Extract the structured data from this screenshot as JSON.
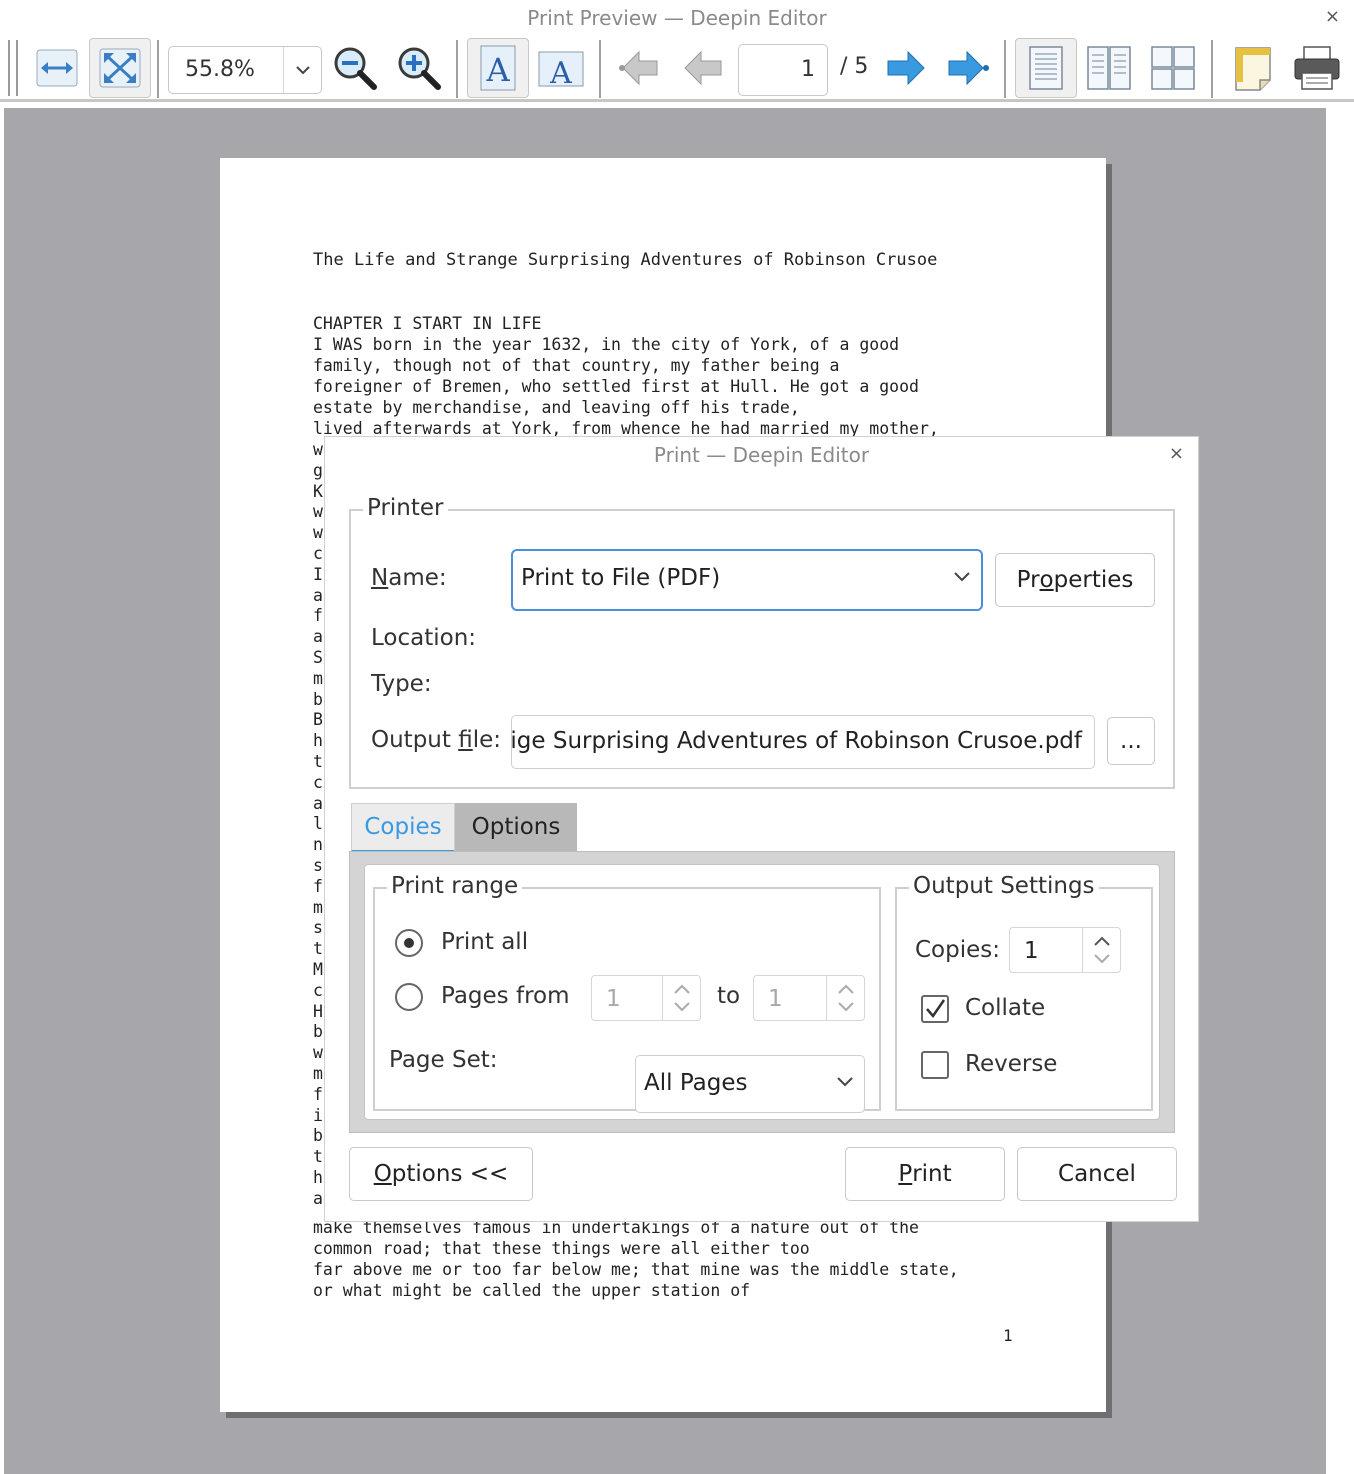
{
  "window": {
    "title": "Print Preview — Deepin Editor",
    "close_glyph": "×"
  },
  "toolbar": {
    "zoom_value": "55.8%",
    "current_page": "1",
    "page_total": "/ 5",
    "icons": [
      "fit-width-icon",
      "fit-page-icon",
      "zoom-out-icon",
      "zoom-in-icon",
      "portrait-icon",
      "landscape-icon",
      "first-page-icon",
      "previous-page-icon",
      "next-page-icon",
      "last-page-icon",
      "single-page-icon",
      "facing-pages-icon",
      "overview-icon",
      "page-setup-icon",
      "print-icon"
    ]
  },
  "preview": {
    "title": "The Life and Strange Surprising Adventures of Robinson Crusoe",
    "lines_top": [
      "CHAPTER I START IN LIFE",
      "I WAS born in the year 1632, in the city of York, of a good",
      "family, though not of that country, my father being a",
      "foreigner of Bremen, who settled first at Hull. He got a good",
      "estate by merchandise, and leaving off his trade,",
      "lived afterwards at York, from whence he had married my mother,"
    ],
    "left_chars": [
      "w",
      "g",
      "K",
      "w",
      "w",
      "c",
      "I",
      "a",
      "f",
      "a",
      "S",
      "m",
      "b",
      "B",
      "h",
      "t",
      "c",
      "a",
      "l",
      "n",
      "s",
      "f",
      "m",
      "s",
      "t",
      "M",
      "c",
      "H",
      "b",
      "w",
      "m",
      "f",
      "i",
      "b",
      "t",
      "h",
      "a"
    ],
    "lines_bottom": [
      "make themselves famous in undertakings of a nature out of the",
      "common road; that these things were all either too",
      "far above me or too far below me; that mine was the middle state,",
      "or what might be called the upper station of"
    ],
    "page_number": "1"
  },
  "dialog": {
    "title": "Print — Deepin Editor",
    "close_glyph": "×",
    "printer_group": "Printer",
    "name_label_u": "N",
    "name_label_rest": "ame:",
    "printer_name": "Print to File (PDF)",
    "properties_pre": "Pr",
    "properties_u": "o",
    "properties_post": "perties",
    "location_label": "Location:",
    "type_label": "Type:",
    "output_file_pre": "Output ",
    "output_file_u": "f",
    "output_file_post": "ile:",
    "output_file_value": "ige Surprising Adventures of Robinson Crusoe.pdf",
    "browse_label": "...",
    "tabs": {
      "copies": "Copies",
      "options": "Options"
    },
    "print_range": {
      "title": "Print range",
      "print_all": "Print all",
      "pages_from": "Pages from",
      "from_value": "1",
      "to_label": "to",
      "to_value": "1",
      "page_set_label": "Page Set:",
      "page_set_value": "All Pages"
    },
    "output_settings": {
      "title": "Output Settings",
      "copies_label": "Copies:",
      "copies_value": "1",
      "collate": "Collate",
      "collate_checked": true,
      "reverse": "Reverse",
      "reverse_checked": false
    },
    "options_toggle_u": "O",
    "options_toggle_rest": "ptions <<",
    "print_u": "P",
    "print_rest": "rint",
    "cancel": "Cancel"
  },
  "colors": {
    "accent": "#3a99e0",
    "preview_bg": "#a7a6aa",
    "focus_border": "#4a8fdb"
  }
}
